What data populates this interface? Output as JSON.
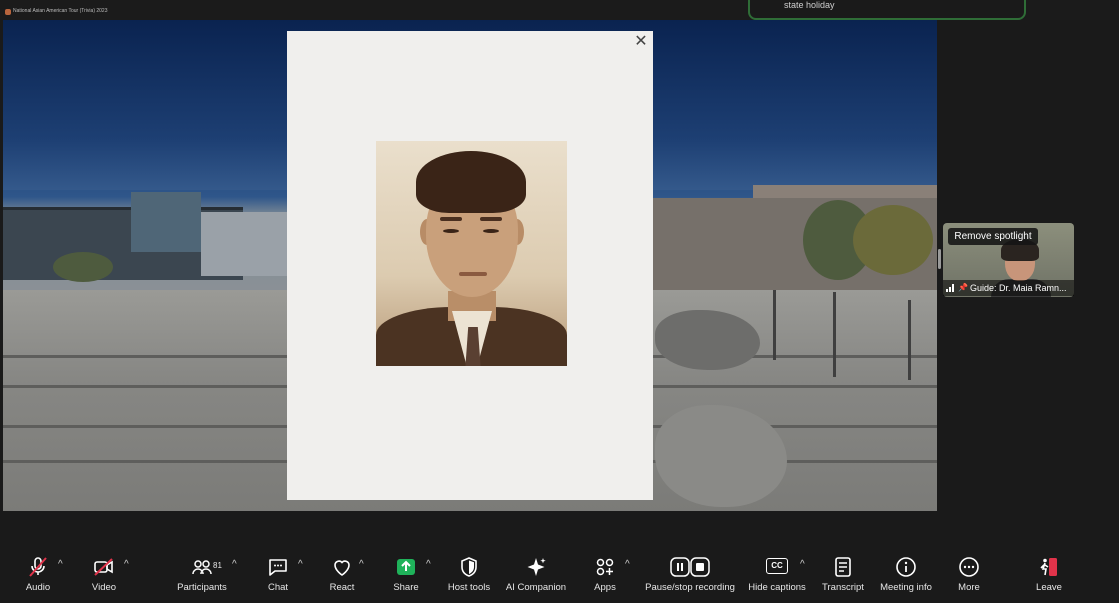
{
  "window": {
    "title": "National Asian American Tour (Trivia) 2023"
  },
  "notification": {
    "text": "state holiday"
  },
  "shared_content": {
    "modal": {
      "close_glyph": "✕"
    }
  },
  "participant_tile": {
    "spotlight_button": "Remove spotlight",
    "name": "Guide: Dr. Maia Ramn...",
    "pin_glyph": "📌"
  },
  "toolbar": {
    "audio": "Audio",
    "video": "Video",
    "participants": "Participants",
    "participants_count": "81",
    "chat": "Chat",
    "react": "React",
    "share": "Share",
    "host_tools": "Host tools",
    "ai_companion": "AI Companion",
    "apps": "Apps",
    "recording": "Pause/stop recording",
    "captions": "Hide captions",
    "captions_badge": "CC",
    "transcript": "Transcript",
    "meeting_info": "Meeting info",
    "more": "More",
    "leave": "Leave",
    "caret": "^"
  },
  "colors": {
    "share_green": "#1fb25a",
    "leave_red": "#e0334a",
    "notification_border": "#2f6d37"
  }
}
